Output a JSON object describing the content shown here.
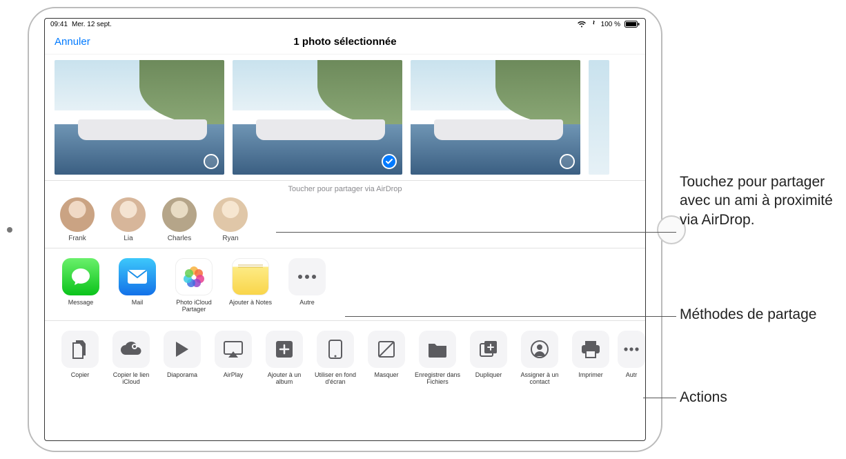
{
  "status": {
    "time": "09:41",
    "date": "Mer. 12 sept.",
    "battery": "100 %"
  },
  "nav": {
    "cancel": "Annuler",
    "title": "1 photo sélectionnée"
  },
  "airdrop": {
    "hint": "Toucher pour partager via AirDrop",
    "contacts": [
      "Frank",
      "Lia",
      "Charles",
      "Ryan"
    ]
  },
  "apps": {
    "items": [
      {
        "label": "Message"
      },
      {
        "label": "Mail"
      },
      {
        "label": "Photo iCloud Partager"
      },
      {
        "label": "Ajouter à Notes"
      },
      {
        "label": "Autre"
      }
    ]
  },
  "actions": {
    "items": [
      {
        "label": "Copier"
      },
      {
        "label": "Copier le lien iCloud"
      },
      {
        "label": "Diaporama"
      },
      {
        "label": "AirPlay"
      },
      {
        "label": "Ajouter à un album"
      },
      {
        "label": "Utiliser en fond d'écran"
      },
      {
        "label": "Masquer"
      },
      {
        "label": "Enregistrer dans Fichiers"
      },
      {
        "label": "Dupliquer"
      },
      {
        "label": "Assigner à un contact"
      },
      {
        "label": "Imprimer"
      },
      {
        "label": "Autr"
      }
    ]
  },
  "callouts": {
    "c1": "Touchez pour partager avec un ami à proximité via AirDrop.",
    "c2": "Méthodes de partage",
    "c3": "Actions"
  },
  "photos": {
    "selected_index": 1
  },
  "contact_colors": [
    "#caa383",
    "#d7b69a",
    "#b5a589",
    "#e0c7a8"
  ]
}
